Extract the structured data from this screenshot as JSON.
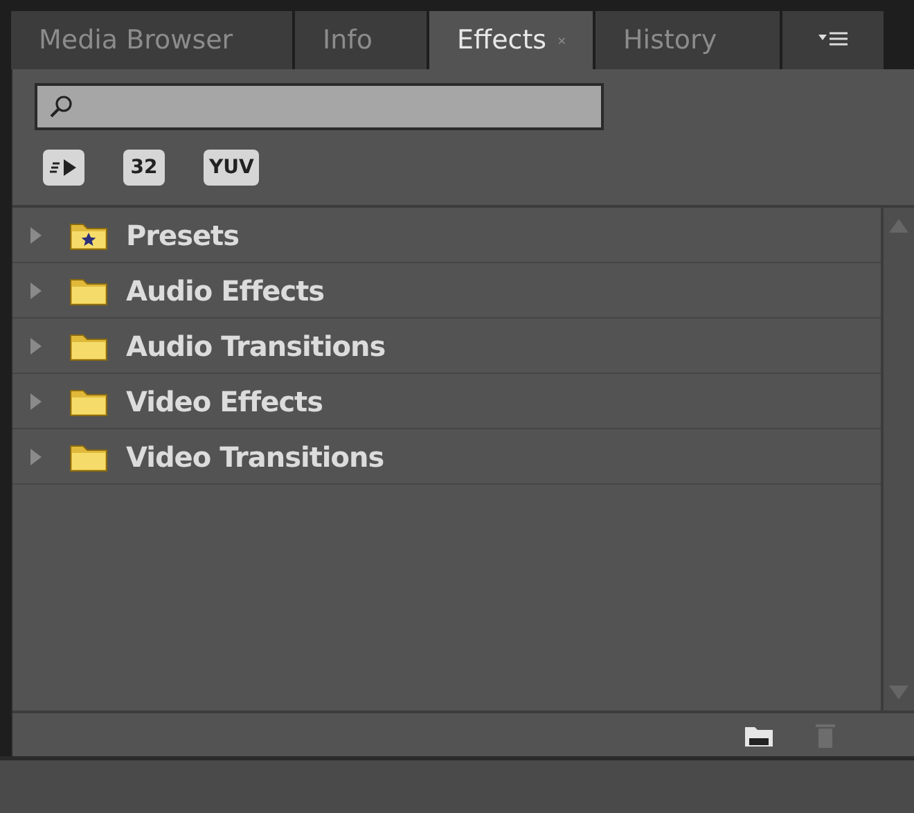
{
  "tabs": [
    {
      "label": "Media Browser",
      "selected": false,
      "closable": false
    },
    {
      "label": "Info",
      "selected": false,
      "closable": false
    },
    {
      "label": "Effects",
      "selected": true,
      "closable": true
    },
    {
      "label": "History",
      "selected": false,
      "closable": false
    }
  ],
  "filter_buttons": [
    {
      "kind": "accelerated"
    },
    {
      "kind": "badge",
      "label": "32"
    },
    {
      "kind": "badge",
      "label": "YUV"
    }
  ],
  "tree": [
    {
      "label": "Presets",
      "kind": "presets",
      "expanded": false
    },
    {
      "label": "Audio Effects",
      "kind": "folder",
      "expanded": false
    },
    {
      "label": "Audio Transitions",
      "kind": "folder",
      "expanded": false
    },
    {
      "label": "Video Effects",
      "kind": "folder",
      "expanded": false
    },
    {
      "label": "Video Transitions",
      "kind": "folder",
      "expanded": false
    }
  ],
  "footer_buttons": [
    {
      "kind": "new-bin",
      "disabled": false
    },
    {
      "kind": "delete",
      "disabled": true
    }
  ]
}
